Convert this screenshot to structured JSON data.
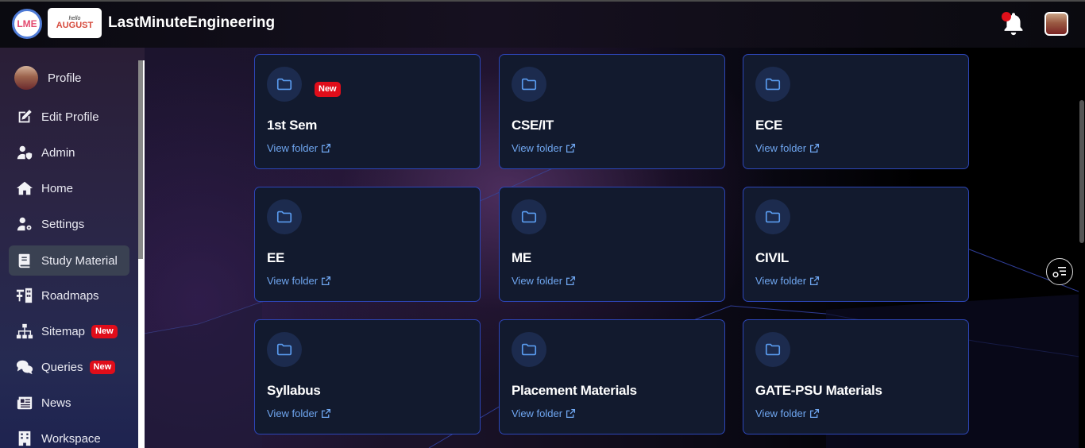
{
  "header": {
    "brand": "LastMinuteEngineering",
    "logo_text": "LME",
    "promo_small": "hello",
    "promo_text": "AUGUST"
  },
  "sidebar": {
    "items": [
      {
        "label": "Profile",
        "icon": "avatar"
      },
      {
        "label": "Edit Profile",
        "icon": "edit-icon"
      },
      {
        "label": "Admin",
        "icon": "user-shield-icon"
      },
      {
        "label": "Home",
        "icon": "home-icon"
      },
      {
        "label": "Settings",
        "icon": "user-gear-icon"
      },
      {
        "label": "Study Material",
        "icon": "book-icon",
        "active": true
      },
      {
        "label": "Roadmaps",
        "icon": "roadmap-icon"
      },
      {
        "label": "Sitemap",
        "icon": "sitemap-icon",
        "badge": "New"
      },
      {
        "label": "Queries",
        "icon": "comments-icon",
        "badge": "New"
      },
      {
        "label": "News",
        "icon": "newspaper-icon"
      },
      {
        "label": "Workspace",
        "icon": "building-icon"
      }
    ]
  },
  "folders": [
    {
      "title": "1st Sem",
      "link": "View folder",
      "badge": "New"
    },
    {
      "title": "CSE/IT",
      "link": "View folder"
    },
    {
      "title": "ECE",
      "link": "View folder"
    },
    {
      "title": "EE",
      "link": "View folder"
    },
    {
      "title": "ME",
      "link": "View folder"
    },
    {
      "title": "CIVIL",
      "link": "View folder"
    },
    {
      "title": "Syllabus",
      "link": "View folder"
    },
    {
      "title": "Placement Materials",
      "link": "View folder"
    },
    {
      "title": "GATE-PSU Materials",
      "link": "View folder"
    }
  ],
  "colors": {
    "accent_blue": "#6fa6f0",
    "card_border": "#2d46b8",
    "badge_red": "#e00d1a"
  }
}
